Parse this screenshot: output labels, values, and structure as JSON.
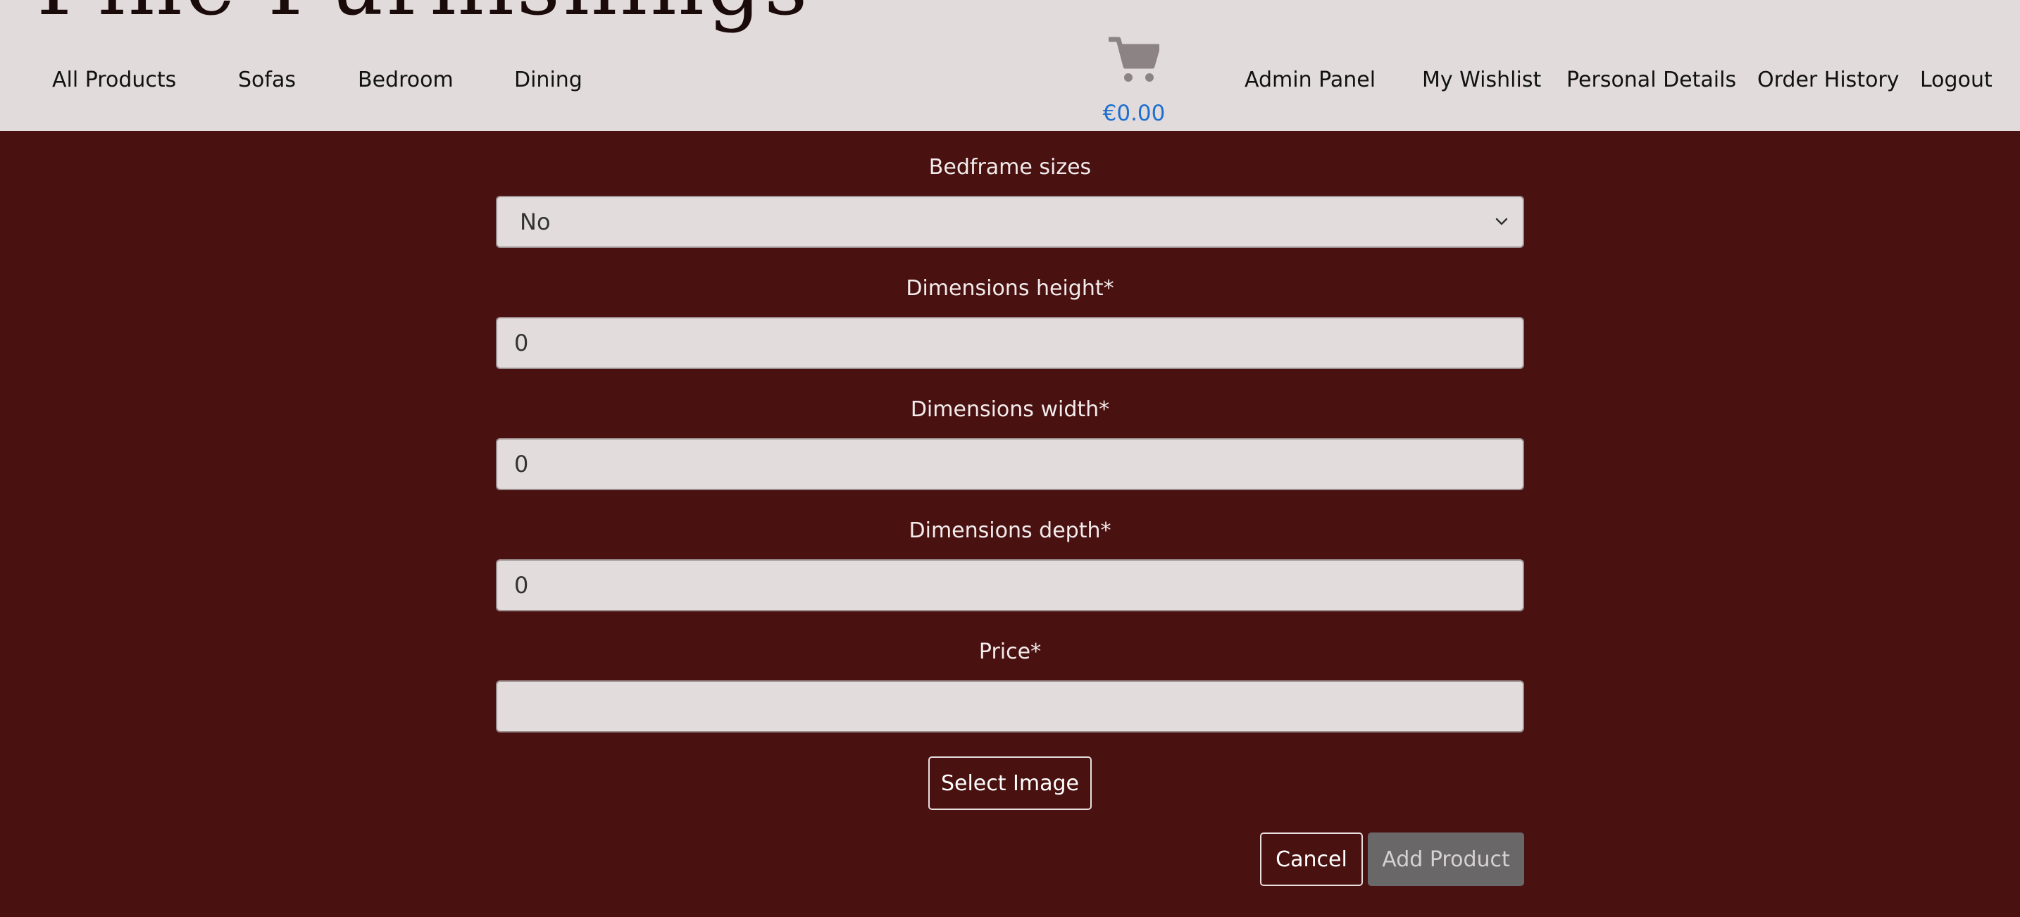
{
  "header": {
    "brand": "Fine Furnishings",
    "nav_left": [
      "All Products",
      "Sofas",
      "Bedroom",
      "Dining"
    ],
    "cart_total": "€0.00",
    "nav_right": [
      "Admin Panel",
      "My Wishlist",
      "Personal Details",
      "Order History",
      "Logout"
    ]
  },
  "form": {
    "bedframe": {
      "label": "Bedframe sizes",
      "value": "No"
    },
    "height": {
      "label": "Dimensions height*",
      "value": "0"
    },
    "width": {
      "label": "Dimensions width*",
      "value": "0"
    },
    "depth": {
      "label": "Dimensions depth*",
      "value": "0"
    },
    "price": {
      "label": "Price*",
      "value": ""
    },
    "select_image_label": "Select Image",
    "cancel_label": "Cancel",
    "add_product_label": "Add Product"
  },
  "colors": {
    "header_bg": "#e2dbdb",
    "page_bg": "#4a1111",
    "field_bg": "#e3dcdc",
    "cart_total": "#1f6fd0",
    "disabled_button": "#6a6769"
  },
  "icons": {
    "cart": "shopping-cart-icon",
    "select_caret": "chevron-down-icon"
  }
}
